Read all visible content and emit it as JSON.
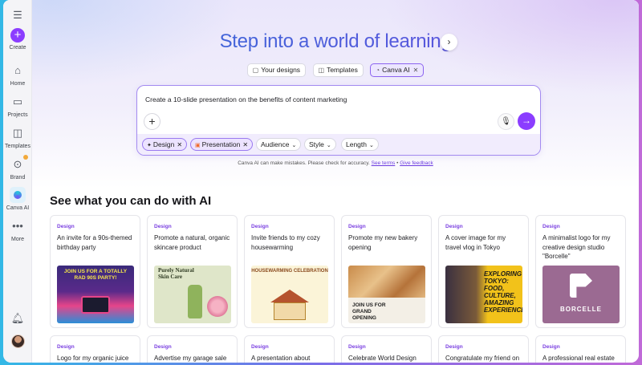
{
  "sidebar": {
    "menu_icon": "hamburger-icon",
    "items": [
      {
        "label": "Create",
        "icon": "plus-icon"
      },
      {
        "label": "Home",
        "icon": "home-icon"
      },
      {
        "label": "Projects",
        "icon": "folder-icon"
      },
      {
        "label": "Templates",
        "icon": "templates-icon"
      },
      {
        "label": "Brand",
        "icon": "brand-icon"
      },
      {
        "label": "Canva AI",
        "icon": "canva-ai-icon"
      },
      {
        "label": "More",
        "icon": "more-icon"
      }
    ],
    "notifications_icon": "bell-icon"
  },
  "hero": {
    "title": "Step into a world of learning",
    "tabs": [
      {
        "label": "Your designs",
        "icon": "designs-icon"
      },
      {
        "label": "Templates",
        "icon": "templates-icon"
      },
      {
        "label": "Canva AI",
        "icon": "canva-ai-icon",
        "active": true
      }
    ]
  },
  "prompt": {
    "text": "Create a 10-slide presentation on the benefits of content marketing",
    "chips": [
      {
        "label": "Design"
      },
      {
        "label": "Presentation"
      }
    ],
    "dropdowns": [
      {
        "label": "Audience"
      },
      {
        "label": "Style"
      },
      {
        "label": "Length"
      }
    ]
  },
  "disclaimer": {
    "text": "Canva AI can make mistakes. Please check for accuracy.",
    "terms_link": "See terms",
    "separator": "•",
    "feedback_link": "Give feedback"
  },
  "section_title": "See what you can do with AI",
  "cards": [
    {
      "category": "Design",
      "text": "An invite for a 90s-themed birthday party",
      "thumb_text": "JOIN US FOR A TOTALLY RAD 90S PARTY!"
    },
    {
      "category": "Design",
      "text": "Promote a natural, organic skincare product",
      "thumb_text": "Purely Natural Skin Care"
    },
    {
      "category": "Design",
      "text": "Invite friends to my cozy housewarming",
      "thumb_text": "HOUSEWARMING CELEBRATION"
    },
    {
      "category": "Design",
      "text": "Promote my new bakery opening",
      "thumb_text": "JOIN US FOR GRAND OPENING"
    },
    {
      "category": "Design",
      "text": "A cover image for my travel vlog in Tokyo",
      "thumb_text": "EXPLORING TOKYO: FOOD, CULTURE, AMAZING EXPERIENCES"
    },
    {
      "category": "Design",
      "text": "A minimalist logo for my creative design studio \"Borcelle\"",
      "thumb_text": "BORCELLE"
    }
  ],
  "cards_row2": [
    {
      "category": "Design",
      "text": "Logo for my organic juice"
    },
    {
      "category": "Design",
      "text": "Advertise my garage sale"
    },
    {
      "category": "Design",
      "text": "A presentation about"
    },
    {
      "category": "Design",
      "text": "Celebrate World Design"
    },
    {
      "category": "Design",
      "text": "Congratulate my friend on"
    },
    {
      "category": "Design",
      "text": "A professional real estate"
    }
  ],
  "colors": {
    "accent": "#8b3dff",
    "category": "#7a3fe0"
  }
}
